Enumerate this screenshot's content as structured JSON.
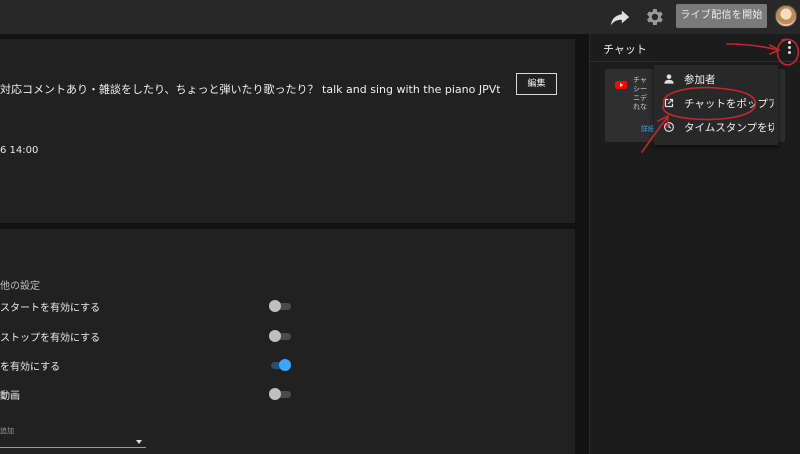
{
  "header": {
    "live_button": "ライブ配信を開始",
    "icons": [
      "share-icon",
      "gear-icon",
      "avatar"
    ]
  },
  "stream": {
    "title": "対応コメントあり・雑談をしたり、ちょっと弾いたり歌ったり？ talk and sing with the piano JPVtub...",
    "edit_button": "編集",
    "datetime": "6 14:00"
  },
  "settings": {
    "heading": "他の設定",
    "rows": [
      {
        "label": "スタートを有効にする",
        "enabled": false
      },
      {
        "label": "ストップを有効にする",
        "enabled": false
      },
      {
        "label": "を有効にする",
        "enabled": true
      },
      {
        "label": "動画",
        "enabled": false
      }
    ],
    "add_label": "追加"
  },
  "chat": {
    "title": "チャット",
    "message_lines": [
      "チャ",
      "シー",
      "ニデ",
      "れな"
    ],
    "message_link": "詳細"
  },
  "menu": {
    "items": [
      {
        "label": "参加者",
        "icon": "person-icon"
      },
      {
        "label": "チャットをポップアウト",
        "icon": "popout-icon"
      },
      {
        "label": "タイムスタンプを切り替え",
        "icon": "clock-icon"
      }
    ]
  },
  "colors": {
    "accent": "#3ea6ff",
    "annotation": "#c0282f",
    "youtube": "#ff0000"
  }
}
